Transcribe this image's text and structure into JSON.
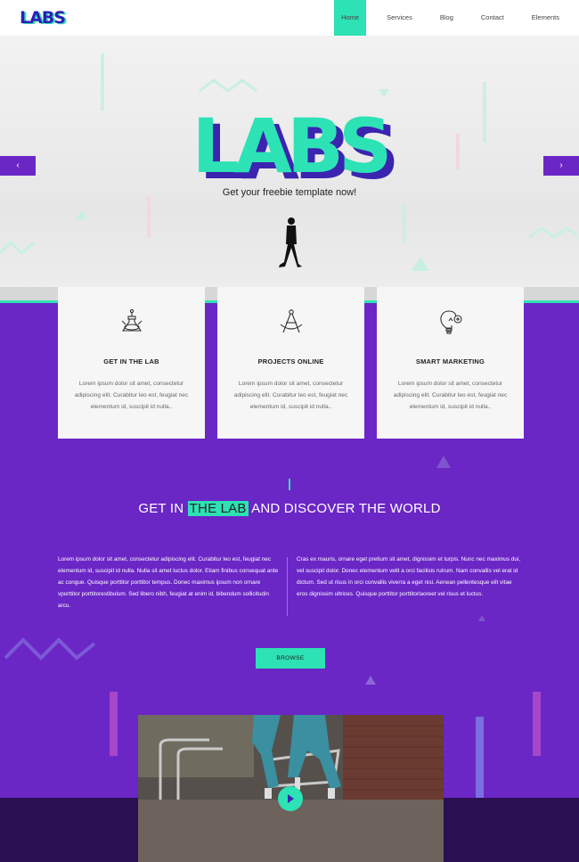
{
  "header": {
    "logo": "LABS",
    "nav": [
      "Home",
      "Services",
      "Blog",
      "Contact",
      "Elements"
    ],
    "active_index": 0
  },
  "hero": {
    "title": "LABS",
    "subtitle": "Get your freebie template now!",
    "prev_icon": "‹",
    "next_icon": "›"
  },
  "cards": [
    {
      "icon": "lab-flask-icon",
      "title": "GET IN THE LAB",
      "text": "Lorem ipsum dolor sit amet, consectetur adipiscing elit. Curabitur leo est, feugiat nec elementum id, suscipit id nulla.."
    },
    {
      "icon": "compass-icon",
      "title": "PROJECTS ONLINE",
      "text": "Lorem ipsum dolor sit amet, consectetur adipiscing elit. Curabitur leo est, feugiat nec elementum id, suscipit id nulla.."
    },
    {
      "icon": "lightbulb-icon",
      "title": "SMART MARKETING",
      "text": "Lorem ipsum dolor sit amet, consectetur adipiscing elit. Curabitur leo est, feugiat nec elementum id, suscipit id nulla.."
    }
  ],
  "section": {
    "title_before": "GET IN ",
    "title_highlight": "THE LAB",
    "title_after": " AND DISCOVER THE WORLD",
    "col_left": "Lorem ipsum dolor sit amet, consectetur adipiscing elit. Curabitur leo est, feugiat nec elementum id, suscipit id nulla. Nulla sit amet luctus dolor. Etiam finibus consequat ante ac congue. Quisque porttitor porttitor tempus. Donec maximus ipsum non ornare vporttitor porttitorestibulum. Sed libero nibh, feugiat at enim id, bibendum sollicitudin arcu.",
    "col_right": "Cras ex mauris, ornare eget pretium sit amet, dignissim et turpis. Nunc nec maximus dui, vel suscipit dolor. Donec elementum velit a orci facilisis rutrum. Nam convallis vel erat id dictum. Sed ut risus in orci convallis viverra a eget nisi. Aenean pellentesque elit vitae eros dignissim ultrices. Quisque porttitor porttitorlaoreet vel risus et luctus.",
    "button": "BROWSE"
  },
  "colors": {
    "purple": "#6b26c6",
    "teal": "#2de2b4",
    "indigo": "#3b24b0",
    "dark": "#2a0f52"
  }
}
